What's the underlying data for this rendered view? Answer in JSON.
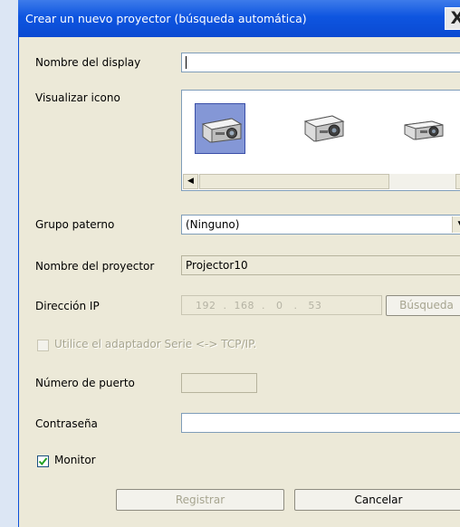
{
  "window": {
    "title": "Crear un nuevo proyector (búsqueda automática)",
    "close_glyph": "X"
  },
  "display_name": {
    "label": "Nombre del display",
    "value": ""
  },
  "icon_picker": {
    "label": "Visualizar icono",
    "icons": [
      "projector-icon-1",
      "projector-icon-2",
      "projector-icon-3"
    ],
    "selected_index": 0,
    "scroll_left": "◀",
    "scroll_right": "▶"
  },
  "parent_group": {
    "label": "Grupo paterno",
    "value": "(Ninguno)",
    "arrow": "▼"
  },
  "projector_name": {
    "label": "Nombre del proyector",
    "value": "Projector10"
  },
  "ip_address": {
    "label": "Dirección IP",
    "octets": [
      "192",
      "168",
      "0",
      "53"
    ],
    "display": "192  .  168  .   0   .   53",
    "search_button": "Búsqueda"
  },
  "serial_adapter": {
    "label": "Utilice el adaptador Serie <-> TCP/IP.",
    "checked": false
  },
  "port_number": {
    "label": "Número de puerto",
    "value": ""
  },
  "password": {
    "label": "Contraseña",
    "value": ""
  },
  "monitor": {
    "label": "Monitor",
    "checked": true
  },
  "buttons": {
    "register": "Registrar",
    "cancel": "Cancelar"
  },
  "colors": {
    "titlebar": "#0a4ad2",
    "dialog_bg": "#ece9d8",
    "selection": "#8497d6"
  }
}
